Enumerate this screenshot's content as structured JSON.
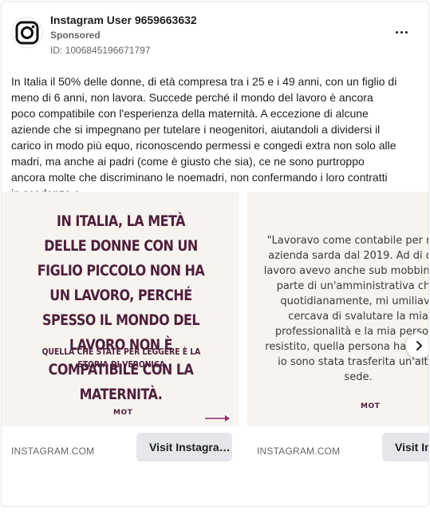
{
  "post": {
    "page_name": "Instagram User 9659663632",
    "sponsored_label": "Sponsored",
    "ad_id": "ID: 1006845196671797",
    "body_text": "In Italia il 50% delle donne, di età compresa tra i 25 e i 49 anni, con un figlio di meno di 6 anni, non lavora. Succede perché il mondo del lavoro è ancora poco compatibile con l'esperienza della maternità. A eccezione di alcune aziende che si impegnano per tutelare i neogenitori, aiutandoli a dividersi il carico in modo più equo, riconoscendo permessi e congedi extra non solo alle madri, ma anche ai padri (come è giusto che sia), ce ne sono purtroppo ancora molte che discriminano le noemadri, non confermando i loro contratti in scadenza o…"
  },
  "icons": {
    "avatar": "instagram-logo-icon",
    "more": "more-options-icon",
    "next": "chevron-right-icon",
    "arrow": "arrow-right-icon"
  },
  "colors": {
    "headline": "#4e1f3c",
    "card_background": "#f7f4ef",
    "cta_background": "#e4e6eb",
    "accent_arrow": "#8b2d6a"
  },
  "carousel": {
    "cards": [
      {
        "headline": "In Italia, la metà delle donne con un figlio piccolo non ha un lavoro, perché spesso il mondo del lavoro non è compatibile con la maternità.",
        "subline": "Quella che state per leggere è la storia di Veronica",
        "brand": "MOT",
        "domain": "INSTAGRAM.COM",
        "cta": "Visit Instagram profile"
      },
      {
        "quote": "\"Lavoravo come contabile per nota azienda sarda dal 2019. Ad di quel lavoro avevo anche sub mobbing da parte di un'amministrativa che, quotidianamente, mi umiliava cercava di svalutare la mia professionalità e la mia persona resistito, quella persona ha lavoro e io sono stata trasferita un'altra sede.",
        "brand": "MOT",
        "domain": "INSTAGRAM.COM",
        "cta": "Visit Instagram profile"
      }
    ]
  }
}
